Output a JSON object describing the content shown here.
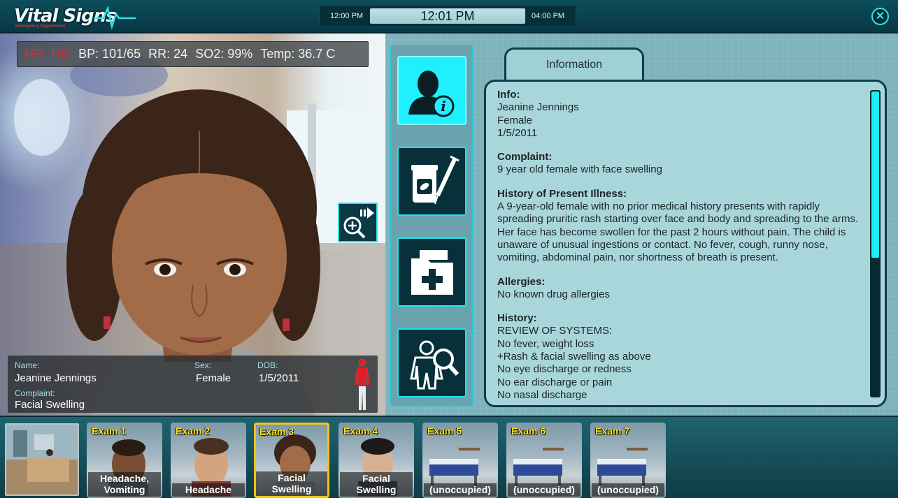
{
  "app": {
    "title": "Vital Signs",
    "subtitle": "Emergency Department"
  },
  "clock": {
    "start": "12:00 PM",
    "current": "12:01 PM",
    "end": "04:00 PM"
  },
  "vitals": {
    "hr": "HR: 109",
    "bp": "BP: 101/65",
    "rr": "RR: 24",
    "so2": "SO2: 99%",
    "temp": "Temp: 36.7 C"
  },
  "patient_card": {
    "name_label": "Name:",
    "name": "Jeanine Jennings",
    "sex_label": "Sex:",
    "sex": "Female",
    "dob_label": "DOB:",
    "dob": "1/5/2011",
    "complaint_label": "Complaint:",
    "complaint": "Facial Swelling"
  },
  "nav": [
    {
      "icon": "patient-info-icon"
    },
    {
      "icon": "medication-icon"
    },
    {
      "icon": "medical-record-icon"
    },
    {
      "icon": "body-exam-icon"
    }
  ],
  "info_tab": {
    "label": "Information"
  },
  "info": {
    "info_heading": "Info:",
    "info_lines": [
      "Jeanine Jennings",
      "Female",
      "1/5/2011"
    ],
    "complaint_heading": "Complaint:",
    "complaint_text": "9 year old female with face swelling",
    "hpi_heading": "History of Present Illness:",
    "hpi_text": "A 9-year-old female with no prior medical history presents with rapidly spreading pruritic rash starting over face and body and spreading to the arms.  Her face has become swollen for the past 2 hours without pain.  The child is unaware of unusual ingestions or contact.  No fever, cough, runny nose, vomiting, abdominal pain, nor shortness of breath is present.",
    "allergies_heading": "Allergies:",
    "allergies_text": "No known drug allergies",
    "history_heading": "History:",
    "history_lines": [
      "REVIEW OF SYSTEMS:",
      "No fever, weight loss",
      "+Rash & facial swelling as above",
      "No eye discharge or redness",
      "No ear discharge or pain",
      "No nasal discharge"
    ]
  },
  "rooms": [
    {
      "title": "Exam 1",
      "label": "Headache, Vomiting",
      "selected": false
    },
    {
      "title": "Exam 2",
      "label": "Headache",
      "selected": false
    },
    {
      "title": "Exam 3",
      "label": "Facial Swelling",
      "selected": true
    },
    {
      "title": "Exam 4",
      "label": "Facial Swelling",
      "selected": false
    },
    {
      "title": "Exam 5",
      "label": "(unoccupied)",
      "selected": false
    },
    {
      "title": "Exam 6",
      "label": "(unoccupied)",
      "selected": false
    },
    {
      "title": "Exam 7",
      "label": "(unoccupied)",
      "selected": false
    }
  ],
  "colors": {
    "accent": "#1ff0ff",
    "hr_alert": "#e02a2a",
    "room_title": "#ffe31a",
    "selected_border": "#f0c419"
  }
}
